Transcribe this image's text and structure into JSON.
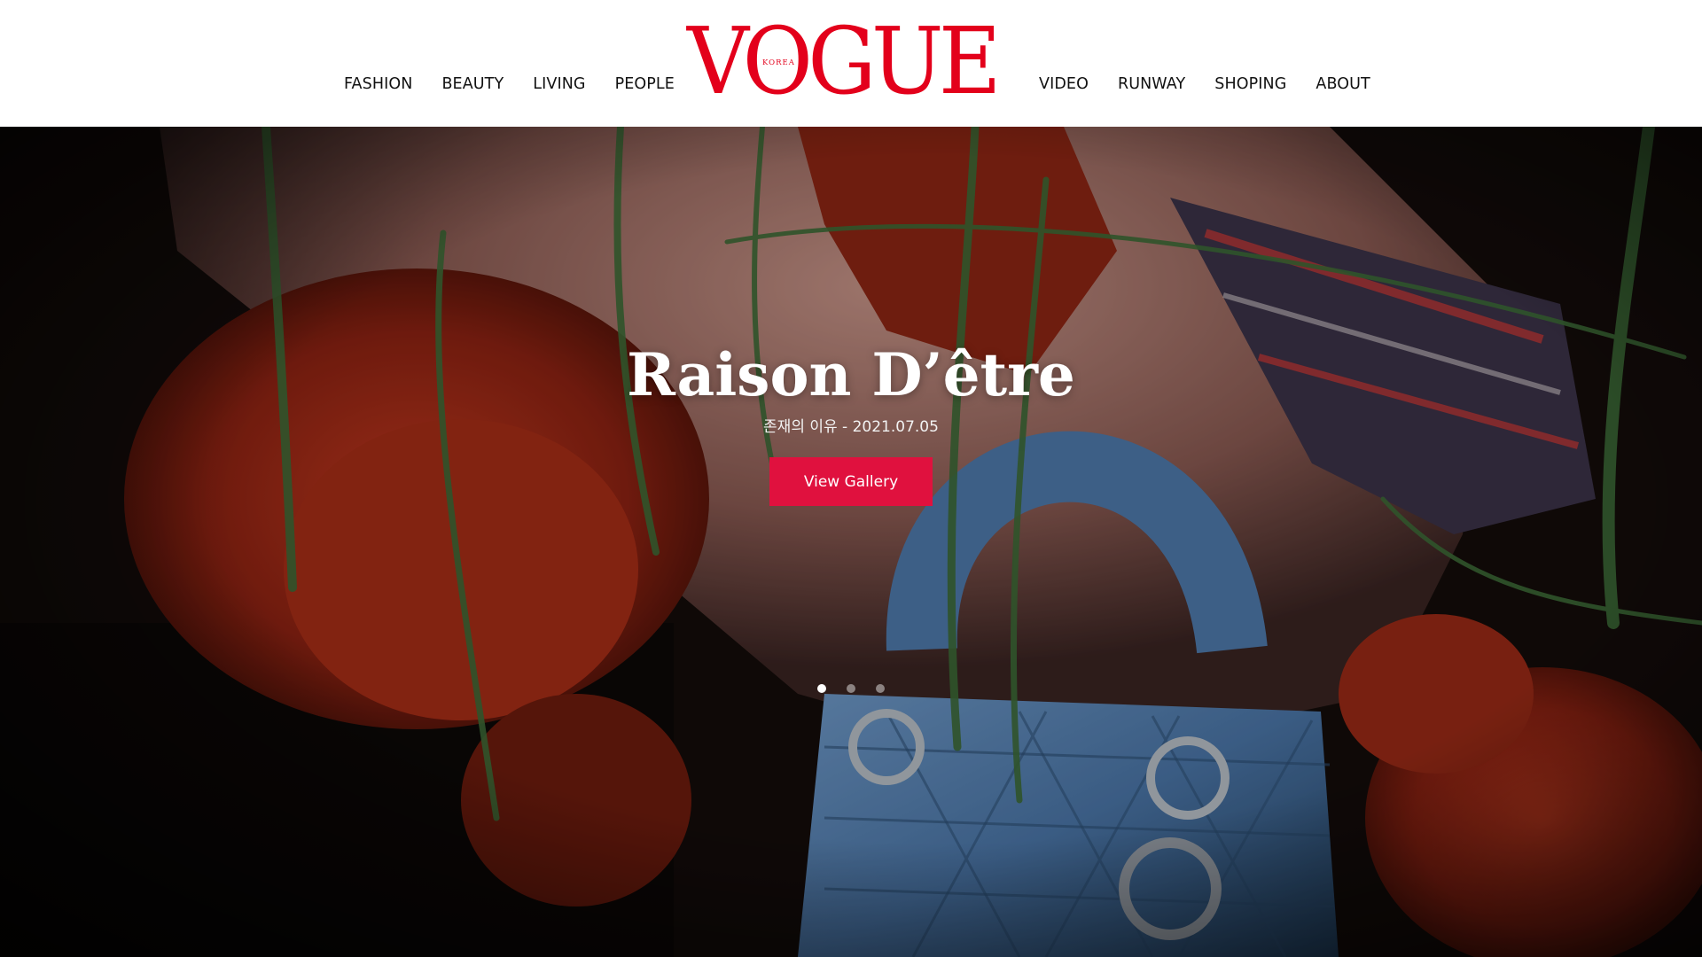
{
  "header": {
    "nav_left": [
      {
        "label": "FASHION"
      },
      {
        "label": "BEAUTY"
      },
      {
        "label": "LIVING"
      },
      {
        "label": "PEOPLE"
      }
    ],
    "nav_right": [
      {
        "label": "VIDEO"
      },
      {
        "label": "RUNWAY"
      },
      {
        "label": "SHOPING"
      },
      {
        "label": "ABOUT"
      }
    ],
    "logo": {
      "word": "VOGUE",
      "sub": "KOREA",
      "color": "#e3001b"
    }
  },
  "hero": {
    "title": "Raison D’être",
    "subtitle": "존재의 이유 - 2021.07.05",
    "button_label": "View Gallery",
    "button_color": "#e0113e",
    "slides_total": 3,
    "active_slide": 1
  }
}
